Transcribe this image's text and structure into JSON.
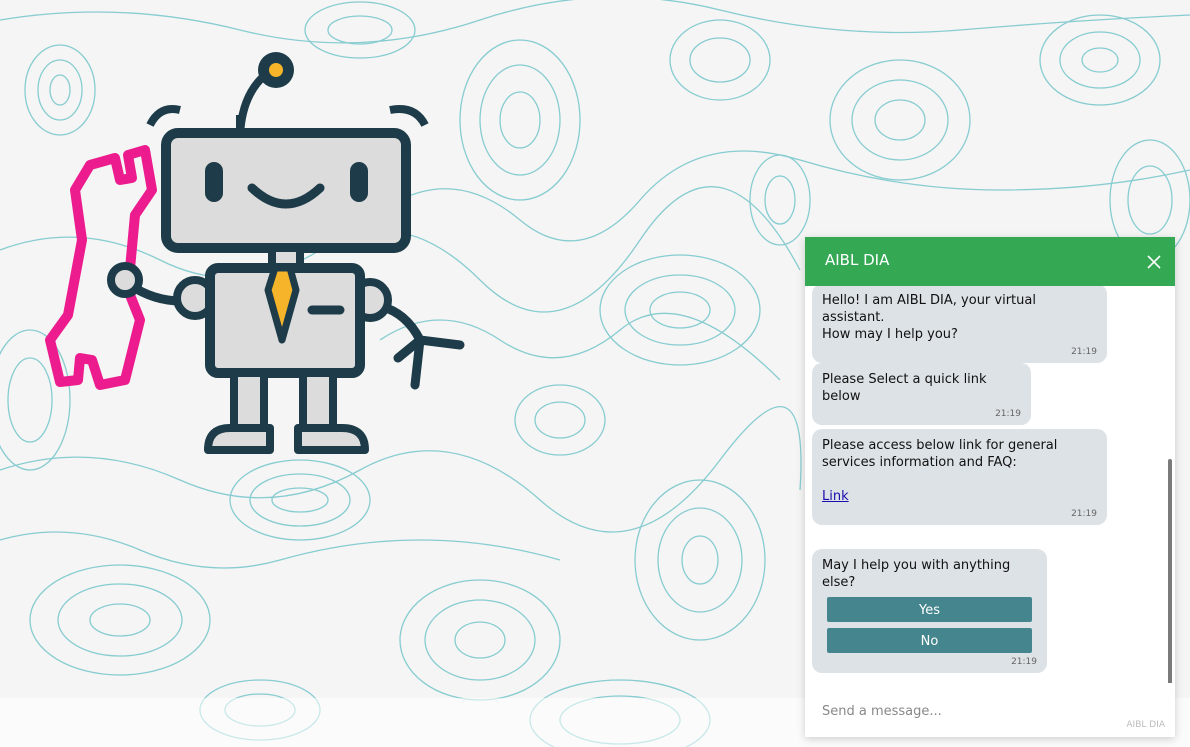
{
  "chat": {
    "title": "AIBL DIA",
    "messages": [
      {
        "text": "Hello! I am AIBL DIA, your virtual assistant.\nHow may I help you?",
        "time": "21:19"
      },
      {
        "text": "Please Select a quick link below",
        "time": "21:19"
      },
      {
        "text": "Please access below link for general services information and FAQ:",
        "link": "Link",
        "time": "21:19"
      },
      {
        "text": "May I help you with anything else?",
        "buttons": [
          "Yes",
          "No"
        ],
        "time": "21:19"
      }
    ],
    "input_placeholder": "Send a message...",
    "brand": "AIBL DIA"
  },
  "colors": {
    "header": "#34a853",
    "bubble": "#dde2e7",
    "quick_button": "#45868e",
    "contour_lines": "#6fc3c9",
    "robot_outline": "#1d3b48",
    "wrench": "#ec1c8e",
    "tie": "#f5b42a"
  },
  "icons": [
    "close-icon",
    "robot-illustration",
    "wrench-icon"
  ]
}
